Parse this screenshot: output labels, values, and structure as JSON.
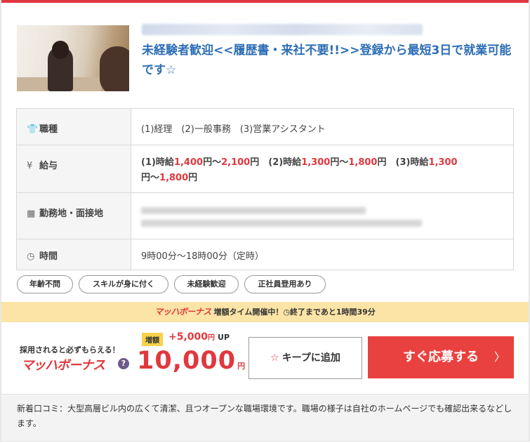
{
  "job": {
    "title": "未経験者歓迎<<履歴書・来社不要!!>>登録から最短3日で就業可能です☆"
  },
  "details": {
    "occupation": {
      "label": "職種",
      "value": "(1)経理　(2)一般事務　(3)営業アシスタント"
    },
    "salary": {
      "label": "給与",
      "s1_prefix": "(1)時給",
      "s1_min": "1,400",
      "s1_max": "2,100",
      "s2_prefix": "(2)時給",
      "s2_min": "1,300",
      "s2_max": "1,800",
      "s3_prefix": "(3)時給",
      "s3_min": "1,300",
      "s3_max": "1,800",
      "yen": "円",
      "tilde": "～"
    },
    "location": {
      "label": "勤務地・面接地"
    },
    "hours": {
      "label": "時間",
      "value": "9時00分～18時00分（定時）"
    }
  },
  "tags": [
    "年齢不問",
    "スキルが身に付く",
    "未経験歓迎",
    "正社員登用あり"
  ],
  "bonus_bar": {
    "logo": "マッハボーナス",
    "text1": "増額タイム開催中！",
    "text2": "終了まであと1時間39分"
  },
  "bonus": {
    "catch": "採用されると必ずもらえる！",
    "logo": "マッハボーナス",
    "help": "?",
    "badge": "増額",
    "plus_amount": "+5,000",
    "plus_unit": "円",
    "up": "UP",
    "amount": "10,000",
    "amount_unit": "円"
  },
  "actions": {
    "keep_label": "キープに追加",
    "apply_label": "すぐ応募する"
  },
  "review": {
    "text": "新着口コミ：大型高層ビル内の広くて清潔、且つオープンな職場環境です。職場の様子は自社のホームページでも確認出来るなどします。"
  },
  "colors": {
    "accent": "#e0383e",
    "title": "#2e6eb5",
    "bonus_bar": "#fbe4a6",
    "badge": "#f8d24a"
  },
  "icons": {
    "occupation": "shirt-icon",
    "salary": "yen-icon",
    "location": "building-icon",
    "hours": "clock-icon",
    "keep": "star-icon",
    "apply": "chevron-right-icon"
  }
}
